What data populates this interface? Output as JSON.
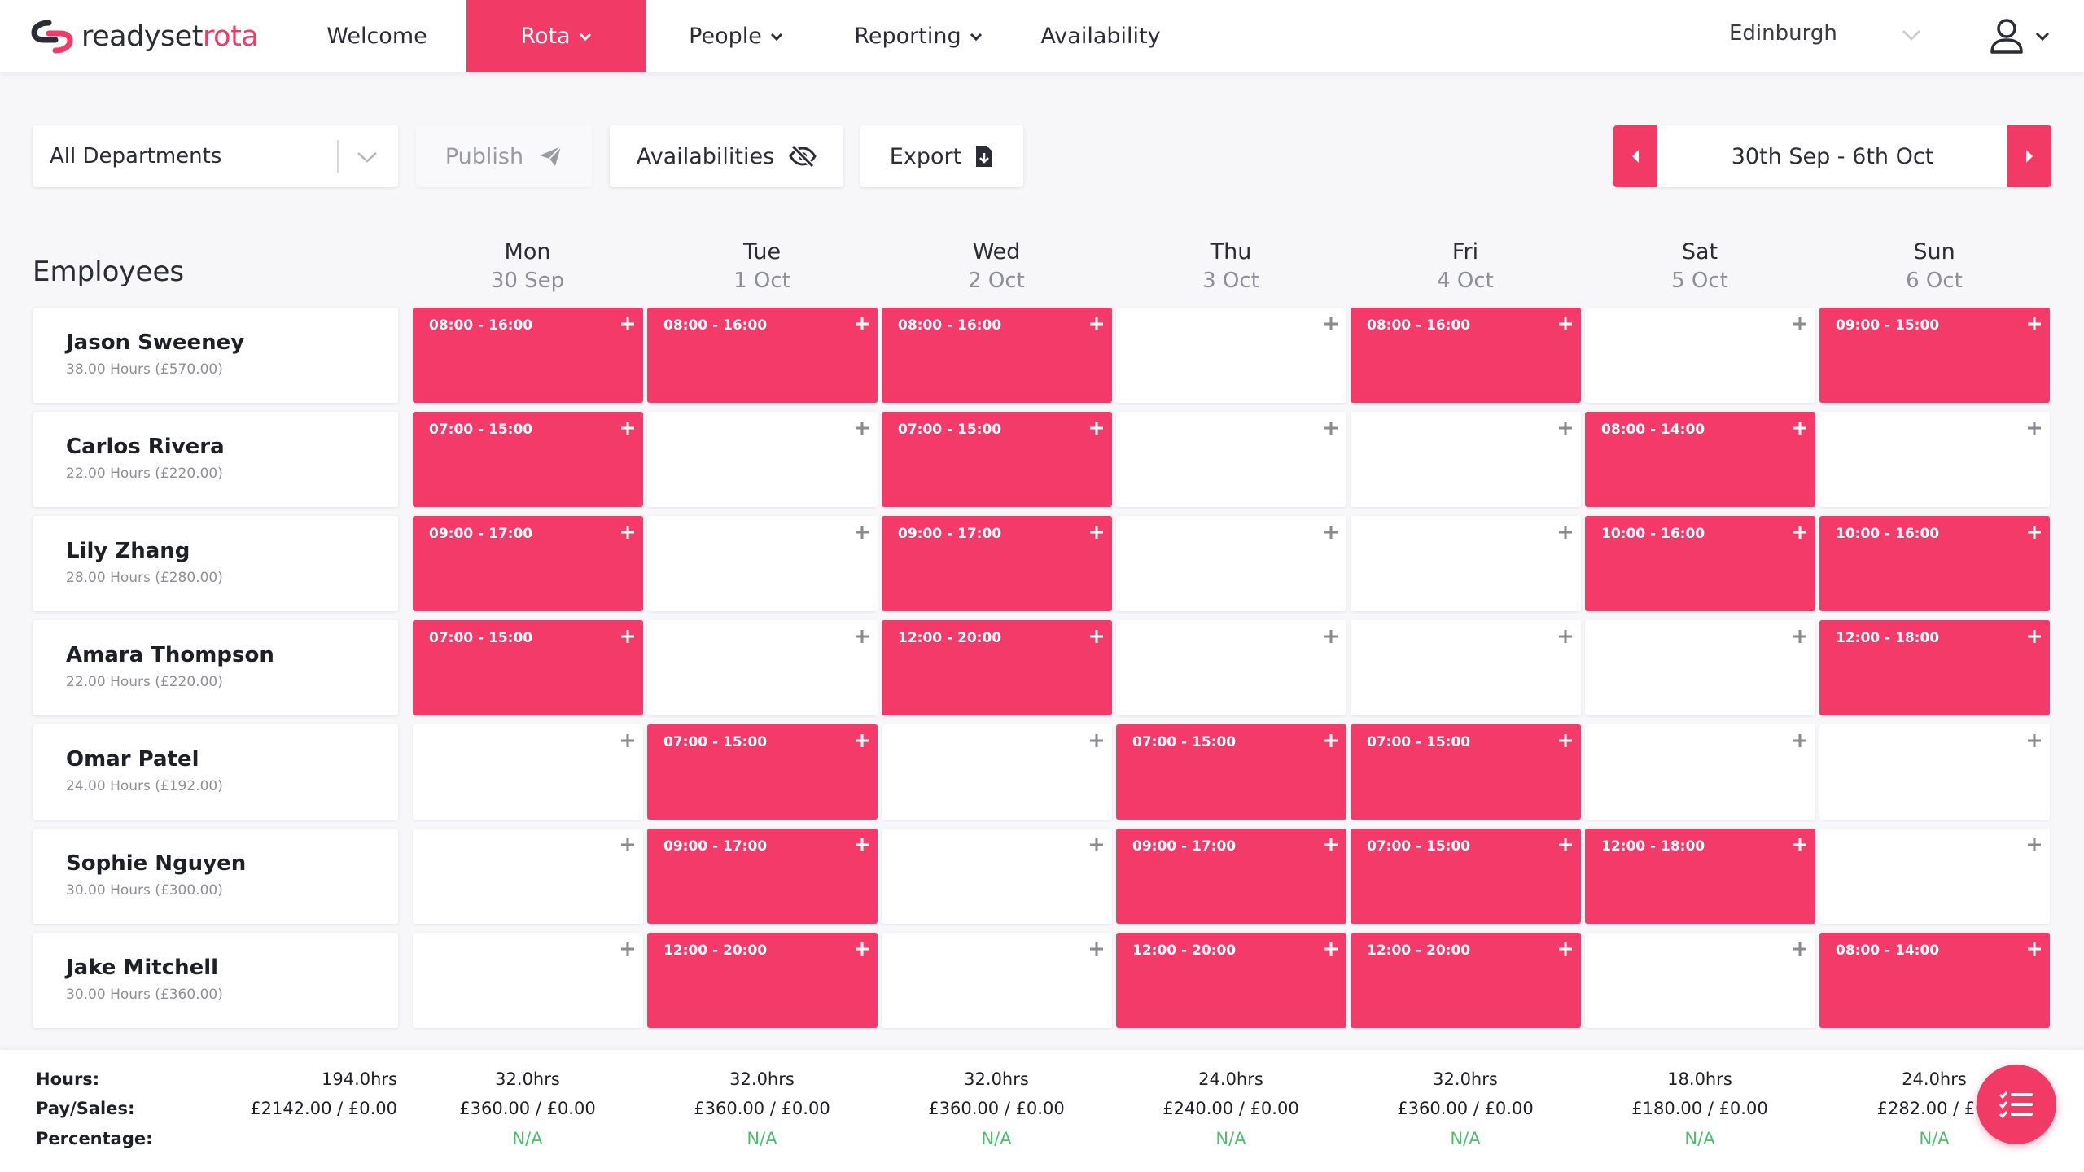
{
  "brand": {
    "name_part1": "readyset",
    "name_part2": "rota",
    "color": "#f23a66"
  },
  "nav": {
    "welcome": "Welcome",
    "rota": "Rota",
    "people": "People",
    "reporting": "Reporting",
    "availability": "Availability",
    "location": "Edinburgh"
  },
  "toolbar": {
    "department": "All Departments",
    "publish": "Publish",
    "availabilities": "Availabilities",
    "export": "Export",
    "week_range": "30th Sep - 6th Oct"
  },
  "grid": {
    "employees_title": "Employees",
    "days": [
      {
        "name": "Mon",
        "date": "30 Sep"
      },
      {
        "name": "Tue",
        "date": "1 Oct"
      },
      {
        "name": "Wed",
        "date": "2 Oct"
      },
      {
        "name": "Thu",
        "date": "3 Oct"
      },
      {
        "name": "Fri",
        "date": "4 Oct"
      },
      {
        "name": "Sat",
        "date": "5 Oct"
      },
      {
        "name": "Sun",
        "date": "6 Oct"
      }
    ],
    "employees": [
      {
        "name": "Jason Sweeney",
        "hours": "38.00 Hours (£570.00)",
        "shifts": [
          "08:00 - 16:00",
          "08:00 - 16:00",
          "08:00 - 16:00",
          "",
          "08:00 - 16:00",
          "",
          "09:00 - 15:00"
        ]
      },
      {
        "name": "Carlos Rivera",
        "hours": "22.00 Hours (£220.00)",
        "shifts": [
          "07:00 - 15:00",
          "",
          "07:00 - 15:00",
          "",
          "",
          "08:00 - 14:00",
          ""
        ]
      },
      {
        "name": "Lily Zhang",
        "hours": "28.00 Hours (£280.00)",
        "shifts": [
          "09:00 - 17:00",
          "",
          "09:00 - 17:00",
          "",
          "",
          "10:00 - 16:00",
          "10:00 - 16:00"
        ]
      },
      {
        "name": "Amara Thompson",
        "hours": "22.00 Hours (£220.00)",
        "shifts": [
          "07:00 - 15:00",
          "",
          "12:00 - 20:00",
          "",
          "",
          "",
          "12:00 - 18:00"
        ]
      },
      {
        "name": "Omar Patel",
        "hours": "24.00 Hours (£192.00)",
        "shifts": [
          "",
          "07:00 - 15:00",
          "",
          "07:00 - 15:00",
          "07:00 - 15:00",
          "",
          ""
        ]
      },
      {
        "name": "Sophie Nguyen",
        "hours": "30.00 Hours (£300.00)",
        "shifts": [
          "",
          "09:00 - 17:00",
          "",
          "09:00 - 17:00",
          "07:00 - 15:00",
          "12:00 - 18:00",
          ""
        ]
      },
      {
        "name": "Jake Mitchell",
        "hours": "30.00 Hours (£360.00)",
        "shifts": [
          "",
          "12:00 - 20:00",
          "",
          "12:00 - 20:00",
          "12:00 - 20:00",
          "",
          "08:00 - 14:00"
        ]
      }
    ]
  },
  "footer": {
    "labels": {
      "hours": "Hours:",
      "pay": "Pay/Sales:",
      "percentage": "Percentage:"
    },
    "total": {
      "hours": "194.0hrs",
      "pay": "£2142.00 / £0.00"
    },
    "days": [
      {
        "hours": "32.0hrs",
        "pay": "£360.00 / £0.00",
        "pct": "N/A"
      },
      {
        "hours": "32.0hrs",
        "pay": "£360.00 / £0.00",
        "pct": "N/A"
      },
      {
        "hours": "32.0hrs",
        "pay": "£360.00 / £0.00",
        "pct": "N/A"
      },
      {
        "hours": "24.0hrs",
        "pay": "£240.00 / £0.00",
        "pct": "N/A"
      },
      {
        "hours": "32.0hrs",
        "pay": "£360.00 / £0.00",
        "pct": "N/A"
      },
      {
        "hours": "18.0hrs",
        "pay": "£180.00 / £0.00",
        "pct": "N/A"
      },
      {
        "hours": "24.0hrs",
        "pay": "£282.00 / £0.",
        "pct": "N/A"
      }
    ]
  }
}
